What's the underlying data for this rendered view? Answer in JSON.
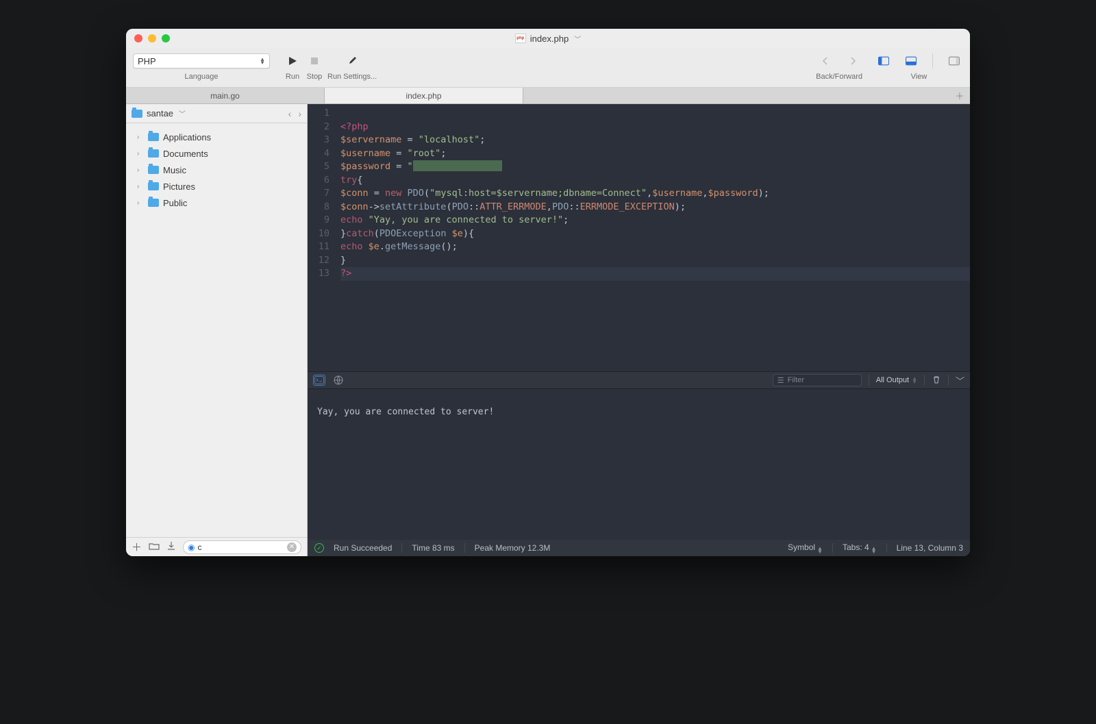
{
  "title": {
    "filename": "index.php",
    "badge": "php"
  },
  "toolbar": {
    "language": {
      "value": "PHP",
      "label": "Language"
    },
    "run": "Run",
    "stop": "Stop",
    "settings": "Run Settings...",
    "backforward": "Back/Forward",
    "view": "View"
  },
  "tabs": [
    {
      "label": "main.go",
      "active": false
    },
    {
      "label": "index.php",
      "active": true
    }
  ],
  "sidebar": {
    "location": "santae",
    "items": [
      {
        "label": "Applications"
      },
      {
        "label": "Documents"
      },
      {
        "label": "Music"
      },
      {
        "label": "Pictures"
      },
      {
        "label": "Public"
      }
    ],
    "filter": {
      "value": "c"
    }
  },
  "code": {
    "lines": [
      1,
      2,
      3,
      4,
      5,
      6,
      7,
      8,
      9,
      10,
      11,
      12,
      13
    ],
    "current_line": 13,
    "l2_open": "<?php",
    "l3": {
      "var": "$servername",
      "eq": " = ",
      "str": "\"localhost\"",
      "semi": ";"
    },
    "l4": {
      "var": "$username",
      "eq": " = ",
      "str": "\"root\"",
      "semi": ";"
    },
    "l5": {
      "var": "$password",
      "eq": " = ",
      "q": "\""
    },
    "l6": {
      "kw": "try",
      "br": "{"
    },
    "l7": {
      "var1": "$conn",
      "eq": " = ",
      "new": "new",
      "fn": " PDO",
      "p1": "(",
      "str": "\"mysql:host=$servername;dbname=Connect\"",
      "c1": ",",
      "var2": "$username",
      "c2": ",",
      "var3": "$password",
      "p2": ");"
    },
    "l8": {
      "var": "$conn",
      "arr": "->",
      "fn": "setAttribute",
      "p1": "(",
      "cls1": "PDO",
      "cc1": "::",
      "c1": "ATTR_ERRMODE",
      "cm": ",",
      "cls2": "PDO",
      "cc2": "::",
      "c2": "ERRMODE_EXCEPTION",
      "p2": ");"
    },
    "l9": {
      "kw": "echo ",
      "str": "\"Yay, you are connected to server!\"",
      "semi": ";"
    },
    "l10": {
      "br": "}",
      "kw": "catch",
      "p1": "(",
      "cls": "PDOException ",
      "var": "$e",
      "p2": "){"
    },
    "l11": {
      "kw": "echo ",
      "var": "$e",
      "dot": ".",
      "fn": "getMessage",
      "p": "();"
    },
    "l12": {
      "br": "}"
    },
    "l13": {
      "close": "?>"
    }
  },
  "console": {
    "filter_placeholder": "Filter",
    "output_scope": "All Output",
    "body": "Yay, you are connected to server!"
  },
  "status": {
    "run": "Run Succeeded",
    "time": "Time 83 ms",
    "mem": "Peak Memory 12.3M",
    "symbol": "Symbol",
    "tabs": "Tabs: 4",
    "pos": "Line 13, Column 3"
  }
}
